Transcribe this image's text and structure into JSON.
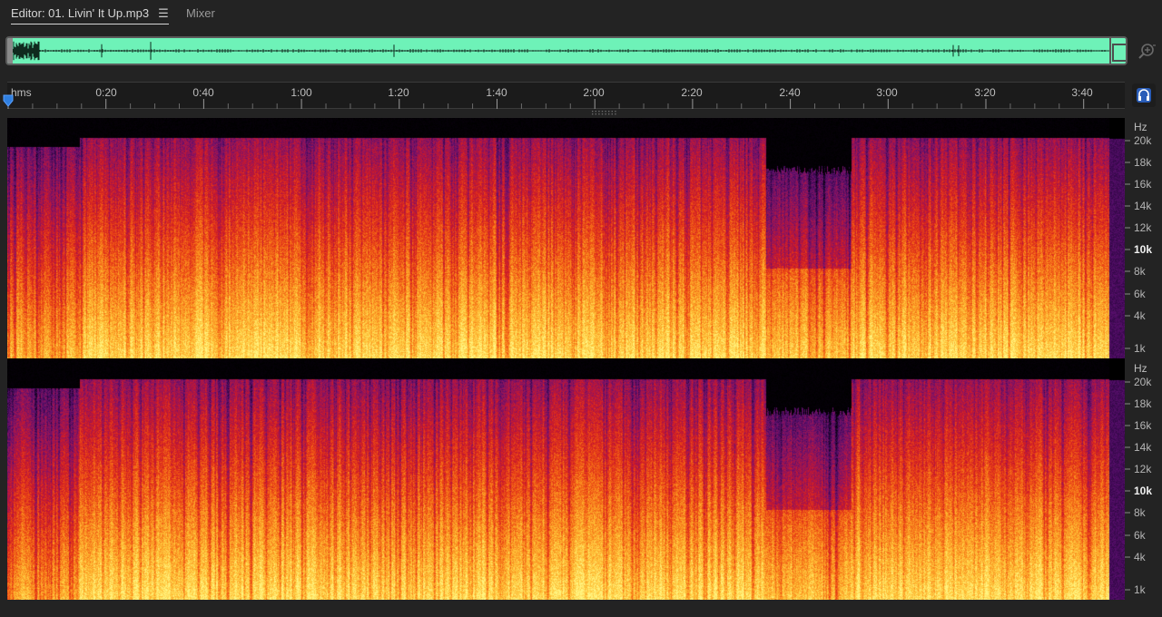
{
  "tabs": {
    "editor_label": "Editor: 01. Livin' It Up.mp3",
    "menu_icon": "☰",
    "mixer_label": "Mixer"
  },
  "overview": {
    "waveform_color": "#6ef2b8",
    "zoom_icon": "zoom-icon"
  },
  "ruler": {
    "unit": "hms",
    "labels": [
      "0:20",
      "0:40",
      "1:00",
      "1:20",
      "1:40",
      "2:00",
      "2:20",
      "2:40",
      "3:00",
      "3:20",
      "3:40"
    ],
    "monitor_icon": "headphones-icon"
  },
  "frequency_axis": {
    "unit": "Hz",
    "labels": [
      "20k",
      "18k",
      "16k",
      "14k",
      "12k",
      "10k",
      "8k",
      "6k",
      "4k",
      "1k"
    ],
    "bold_label": "10k"
  },
  "spectrogram": {
    "channels": 2,
    "palette": [
      "#000000",
      "#3a0a5a",
      "#8a1a6a",
      "#d0202a",
      "#f05a1a",
      "#ffb030",
      "#ffff80"
    ]
  }
}
